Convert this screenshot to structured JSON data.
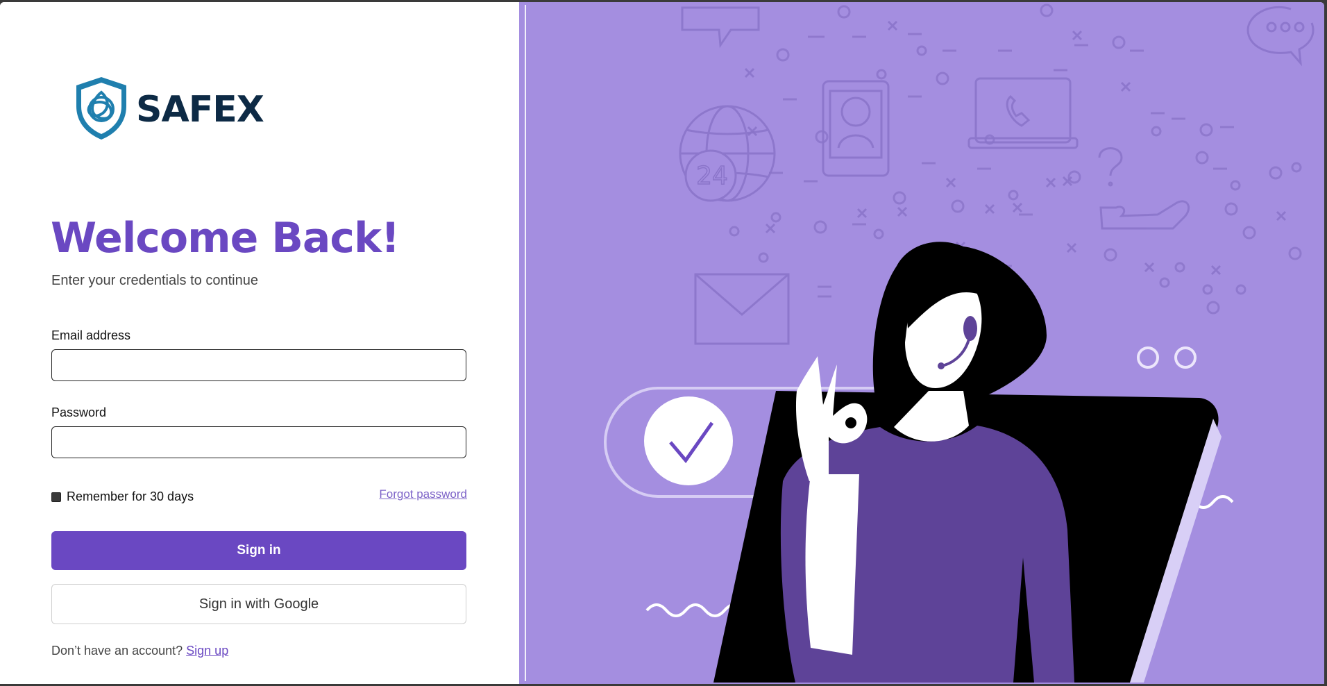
{
  "brand": {
    "name": "SAFEX",
    "logo_icon": "shield-trinity-icon"
  },
  "welcome": {
    "title": "Welcome Back!",
    "subtitle": "Enter your credentials to continue"
  },
  "form": {
    "email_label": "Email address",
    "email_value": "",
    "password_label": "Password",
    "password_value": "",
    "remember_label": "Remember for 30 days",
    "remember_checked": false,
    "forgot_label": "Forgot password",
    "sign_in_label": "Sign in",
    "google_label": "Sign in with Google"
  },
  "signup": {
    "prompt": "Don’t have an account?",
    "link_label": "Sign up"
  },
  "illustration": {
    "badge_number": "24",
    "question_mark": "?"
  },
  "colors": {
    "primary": "#6a48c2",
    "panel": "#a48ee0",
    "navy": "#0d2a45",
    "shield": "#1f7fae"
  }
}
